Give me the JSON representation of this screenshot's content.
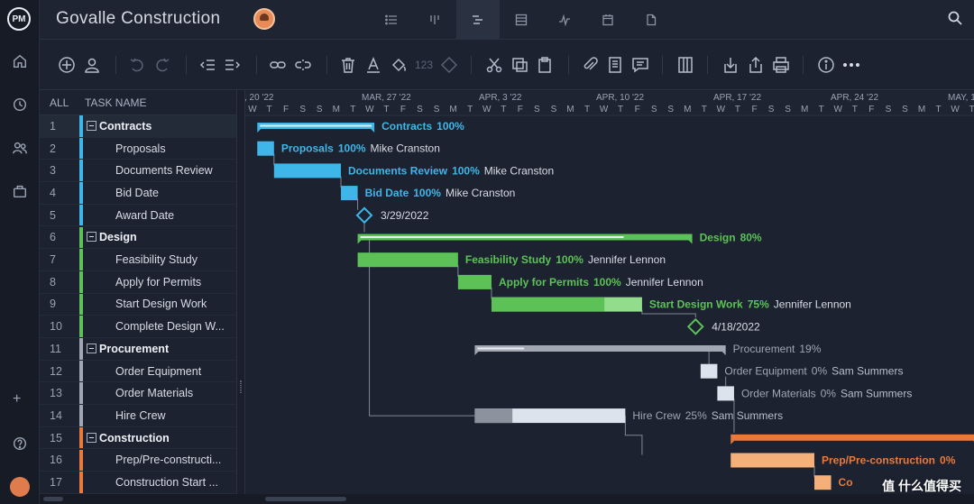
{
  "app": {
    "logo": "PM",
    "title": "Govalle Construction"
  },
  "view_tabs": [
    {
      "name": "list-view-icon",
      "active": false
    },
    {
      "name": "board-view-icon",
      "active": false
    },
    {
      "name": "gantt-view-icon",
      "active": true
    },
    {
      "name": "sheet-view-icon",
      "active": false
    },
    {
      "name": "dashboard-view-icon",
      "active": false
    },
    {
      "name": "calendar-view-icon",
      "active": false
    },
    {
      "name": "files-view-icon",
      "active": false
    }
  ],
  "toolbar": {
    "number_format": "123"
  },
  "grid": {
    "col_all": "ALL",
    "col_name": "TASK NAME",
    "rows": [
      {
        "num": "1",
        "name": "Contracts",
        "parent": true,
        "color": "#3fb6e8"
      },
      {
        "num": "2",
        "name": "Proposals",
        "parent": false,
        "color": "#3fb6e8"
      },
      {
        "num": "3",
        "name": "Documents Review",
        "parent": false,
        "color": "#3fb6e8"
      },
      {
        "num": "4",
        "name": "Bid Date",
        "parent": false,
        "color": "#3fb6e8"
      },
      {
        "num": "5",
        "name": "Award Date",
        "parent": false,
        "color": "#3fb6e8"
      },
      {
        "num": "6",
        "name": "Design",
        "parent": true,
        "color": "#5cc257"
      },
      {
        "num": "7",
        "name": "Feasibility Study",
        "parent": false,
        "color": "#5cc257"
      },
      {
        "num": "8",
        "name": "Apply for Permits",
        "parent": false,
        "color": "#5cc257"
      },
      {
        "num": "9",
        "name": "Start Design Work",
        "parent": false,
        "color": "#5cc257"
      },
      {
        "num": "10",
        "name": "Complete Design W...",
        "parent": false,
        "color": "#5cc257"
      },
      {
        "num": "11",
        "name": "Procurement",
        "parent": true,
        "color": "#a0a6b2"
      },
      {
        "num": "12",
        "name": "Order Equipment",
        "parent": false,
        "color": "#a0a6b2"
      },
      {
        "num": "13",
        "name": "Order Materials",
        "parent": false,
        "color": "#a0a6b2"
      },
      {
        "num": "14",
        "name": "Hire Crew",
        "parent": false,
        "color": "#a0a6b2"
      },
      {
        "num": "15",
        "name": "Construction",
        "parent": true,
        "color": "#ea7a3c"
      },
      {
        "num": "16",
        "name": "Prep/Pre-constructi...",
        "parent": false,
        "color": "#ea7a3c"
      },
      {
        "num": "17",
        "name": "Construction Start ...",
        "parent": false,
        "color": "#ea7a3c"
      }
    ]
  },
  "timeline": {
    "weeks": [
      ", 20 '22",
      "MAR, 27 '22",
      "APR, 3 '22",
      "APR, 10 '22",
      "APR, 17 '22",
      "APR, 24 '22",
      "MAY, 1"
    ],
    "days": [
      "W",
      "T",
      "F",
      "S",
      "S",
      "M",
      "T",
      "W",
      "T",
      "F",
      "S",
      "S",
      "M",
      "T",
      "W",
      "T",
      "F",
      "S",
      "S",
      "M",
      "T",
      "W",
      "T",
      "F",
      "S",
      "S",
      "M",
      "T",
      "W",
      "T",
      "F",
      "S",
      "S",
      "M",
      "T",
      "W",
      "T",
      "F",
      "S",
      "S",
      "M",
      "T",
      "W",
      "T"
    ],
    "tasks": [
      {
        "row": 0,
        "type": "summary",
        "start": 0.5,
        "end": 7.5,
        "progress": 100,
        "color": "#3fb6e8",
        "label": "Contracts",
        "pct": "100%",
        "assignee": ""
      },
      {
        "row": 1,
        "type": "task",
        "start": 0.5,
        "end": 1.5,
        "progress": 100,
        "color": "#3fb6e8",
        "label": "Proposals",
        "pct": "100%",
        "assignee": "Mike Cranston"
      },
      {
        "row": 2,
        "type": "task",
        "start": 1.5,
        "end": 5.5,
        "progress": 100,
        "color": "#3fb6e8",
        "label": "Documents Review",
        "pct": "100%",
        "assignee": "Mike Cranston"
      },
      {
        "row": 3,
        "type": "task",
        "start": 5.5,
        "end": 6.5,
        "progress": 100,
        "color": "#3fb6e8",
        "label": "Bid Date",
        "pct": "100%",
        "assignee": "Mike Cranston"
      },
      {
        "row": 4,
        "type": "milestone",
        "start": 6.9,
        "color": "#3fb6e8",
        "date": "3/29/2022"
      },
      {
        "row": 5,
        "type": "summary",
        "start": 6.5,
        "end": 26.5,
        "progress": 80,
        "color": "#5cc257",
        "label": "Design",
        "pct": "80%",
        "assignee": ""
      },
      {
        "row": 6,
        "type": "task",
        "start": 6.5,
        "end": 12.5,
        "progress": 100,
        "color": "#5cc257",
        "label": "Feasibility Study",
        "pct": "100%",
        "assignee": "Jennifer Lennon"
      },
      {
        "row": 7,
        "type": "task",
        "start": 12.5,
        "end": 14.5,
        "progress": 100,
        "color": "#5cc257",
        "label": "Apply for Permits",
        "pct": "100%",
        "assignee": "Jennifer Lennon"
      },
      {
        "row": 8,
        "type": "task",
        "start": 14.5,
        "end": 23.5,
        "progress": 75,
        "color": "#5cc257",
        "label": "Start Design Work",
        "pct": "75%",
        "assignee": "Jennifer Lennon"
      },
      {
        "row": 9,
        "type": "milestone",
        "start": 26.7,
        "color": "#5cc257",
        "date": "4/18/2022"
      },
      {
        "row": 10,
        "type": "summary",
        "start": 13.5,
        "end": 28.5,
        "progress": 19,
        "color": "#a0a6b2",
        "label": "Procurement",
        "pct": "19%",
        "assignee": ""
      },
      {
        "row": 11,
        "type": "task",
        "start": 27.0,
        "end": 28.0,
        "progress": 0,
        "color": "#a0a6b2",
        "label": "Order Equipment",
        "pct": "0%",
        "assignee": "Sam Summers"
      },
      {
        "row": 12,
        "type": "task",
        "start": 28.0,
        "end": 29.0,
        "progress": 0,
        "color": "#a0a6b2",
        "label": "Order Materials",
        "pct": "0%",
        "assignee": "Sam Summers"
      },
      {
        "row": 13,
        "type": "task",
        "start": 13.5,
        "end": 22.5,
        "progress": 25,
        "color": "#a0a6b2",
        "label": "Hire Crew",
        "pct": "25%",
        "assignee": "Sam Summers"
      },
      {
        "row": 14,
        "type": "summary",
        "start": 28.8,
        "end": 43.5,
        "progress": 0,
        "color": "#ea7a3c",
        "label": "",
        "pct": "",
        "assignee": ""
      },
      {
        "row": 15,
        "type": "task",
        "start": 28.8,
        "end": 33.8,
        "progress": 0,
        "color": "#ea7a3c",
        "label": "Prep/Pre-construction",
        "pct": "0%",
        "assignee": ""
      },
      {
        "row": 16,
        "type": "task",
        "start": 33.8,
        "end": 34.8,
        "progress": 0,
        "color": "#ea7a3c",
        "label": "Co",
        "pct": "",
        "assignee": ""
      }
    ]
  },
  "watermark": "值 什么值得买"
}
